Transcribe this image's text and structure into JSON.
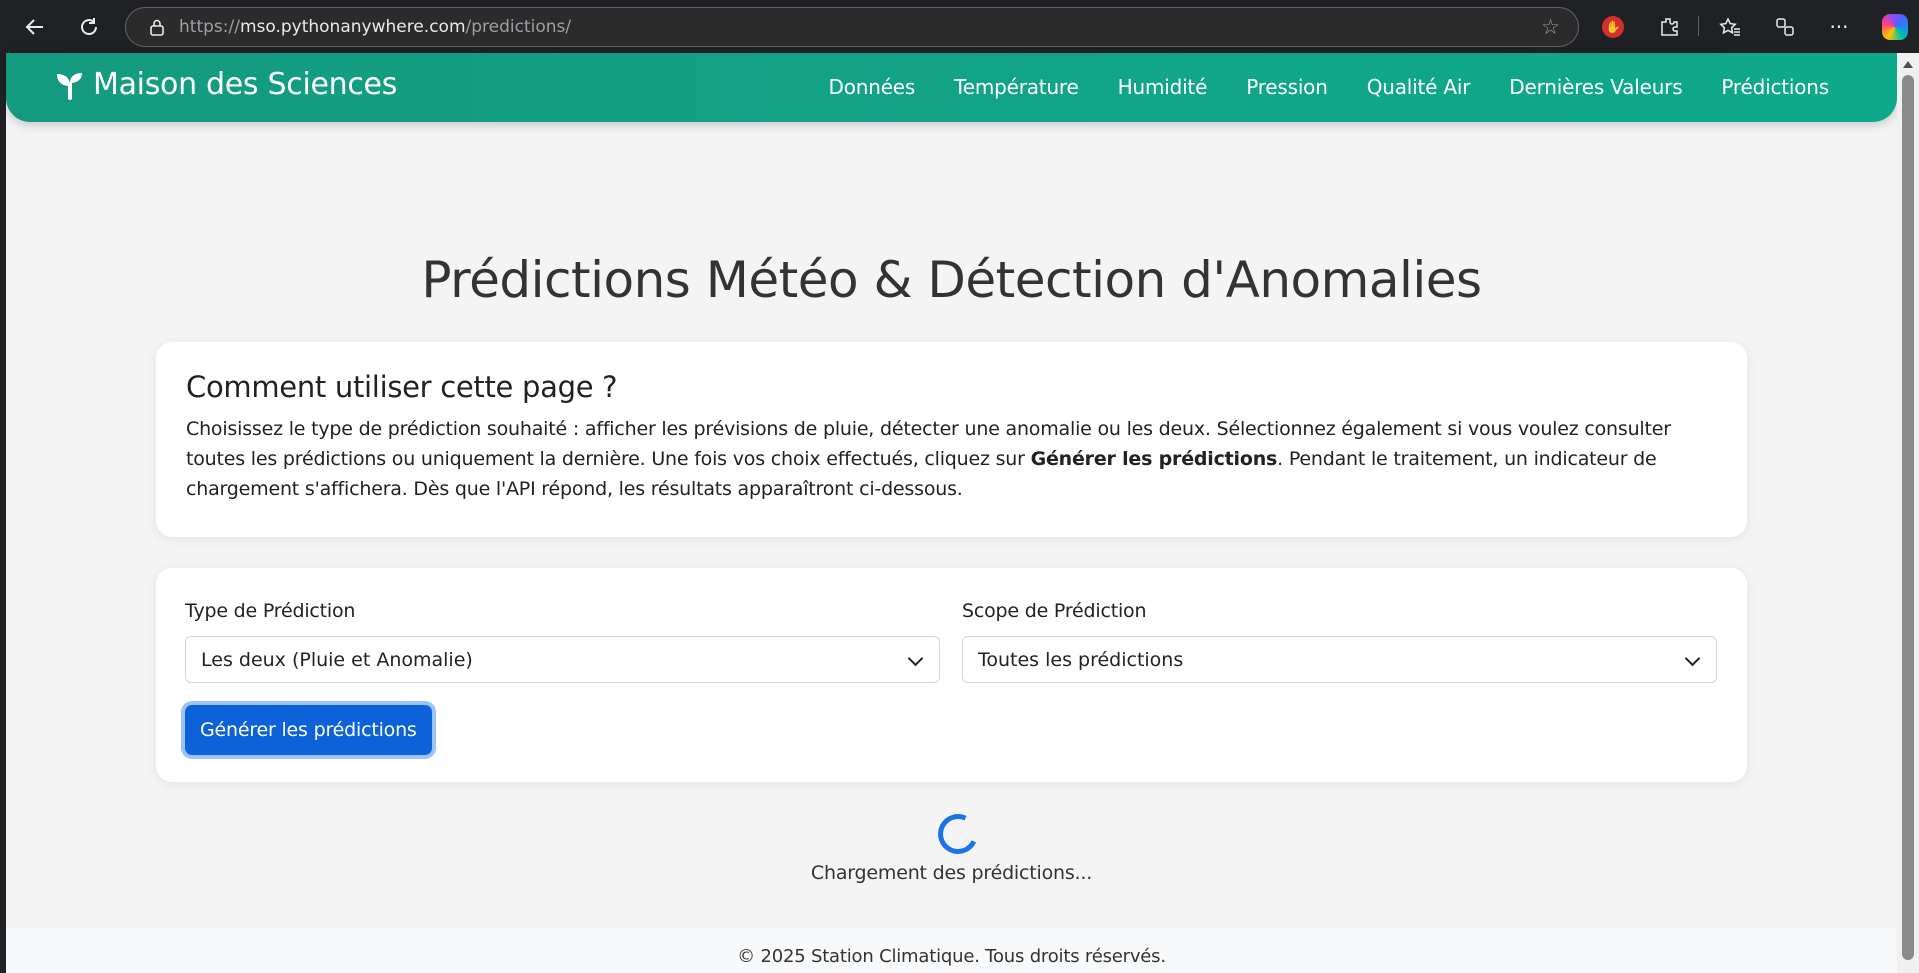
{
  "browser": {
    "url_host": "mso.pythonanywhere.com",
    "url_scheme": "https://",
    "url_path": "/predictions/"
  },
  "site": {
    "brand": "Maison des Sciences",
    "nav": [
      "Données",
      "Température",
      "Humidité",
      "Pression",
      "Qualité Air",
      "Dernières Valeurs",
      "Prédictions"
    ]
  },
  "page": {
    "title": "Prédictions Météo & Détection d'Anomalies",
    "info_heading": "Comment utiliser cette page ?",
    "info_text_1": "Choisissez le type de prédiction souhaité : afficher les prévisions de pluie, détecter une anomalie ou les deux. Sélectionnez également si vous voulez consulter toutes les prédictions ou uniquement la dernière. Une fois vos choix effectués, cliquez sur ",
    "info_text_bold": "Générer les prédictions",
    "info_text_2": ". Pendant le traitement, un indicateur de chargement s'affichera. Dès que l'API répond, les résultats apparaîtront ci-dessous.",
    "type_label": "Type de Prédiction",
    "type_value": "Les deux (Pluie et Anomalie)",
    "scope_label": "Scope de Prédiction",
    "scope_value": "Toutes les prédictions",
    "generate_button": "Générer les prédictions",
    "loading_text": "Chargement des prédictions...",
    "footer": "© 2025 Station Climatique. Tous droits réservés."
  }
}
